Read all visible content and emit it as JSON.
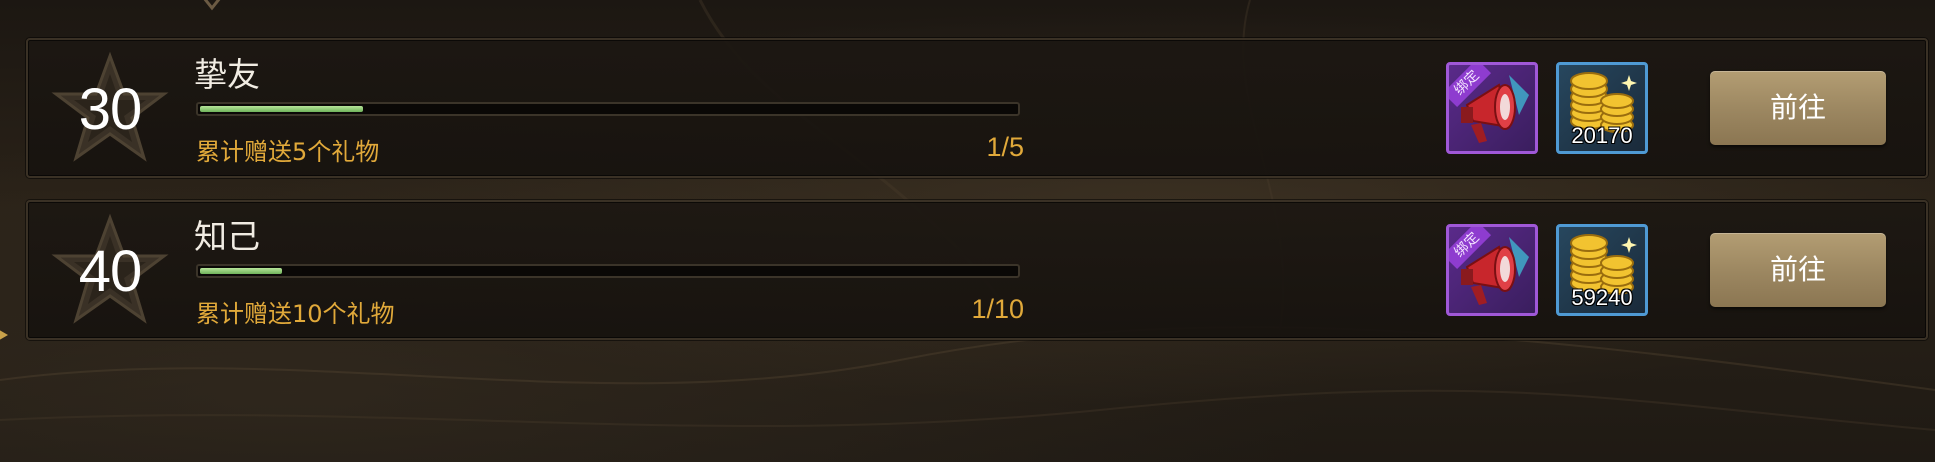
{
  "tasks": [
    {
      "level": "30",
      "title": "挚友",
      "progress": 0.2,
      "description": "累计赠送5个礼物",
      "progress_text": "1/5",
      "rewards": [
        {
          "icon": "megaphone-icon",
          "tag": "绑定",
          "rarity_color": "#a058d8"
        },
        {
          "icon": "gold-coins-icon",
          "count": "20170",
          "rarity_color": "#4f9ad4"
        }
      ],
      "button_label": "前往"
    },
    {
      "level": "40",
      "title": "知己",
      "progress": 0.1,
      "description": "累计赠送10个礼物",
      "progress_text": "1/10",
      "rewards": [
        {
          "icon": "megaphone-icon",
          "tag": "绑定",
          "rarity_color": "#a058d8"
        },
        {
          "icon": "gold-coins-icon",
          "count": "59240",
          "rarity_color": "#4f9ad4"
        }
      ],
      "button_label": "前往"
    }
  ],
  "colors": {
    "accent_gold": "#e1a93a",
    "progress_green": "#6fb35a",
    "button_bronze": "#9b8660",
    "title_white": "#f1ece3"
  }
}
